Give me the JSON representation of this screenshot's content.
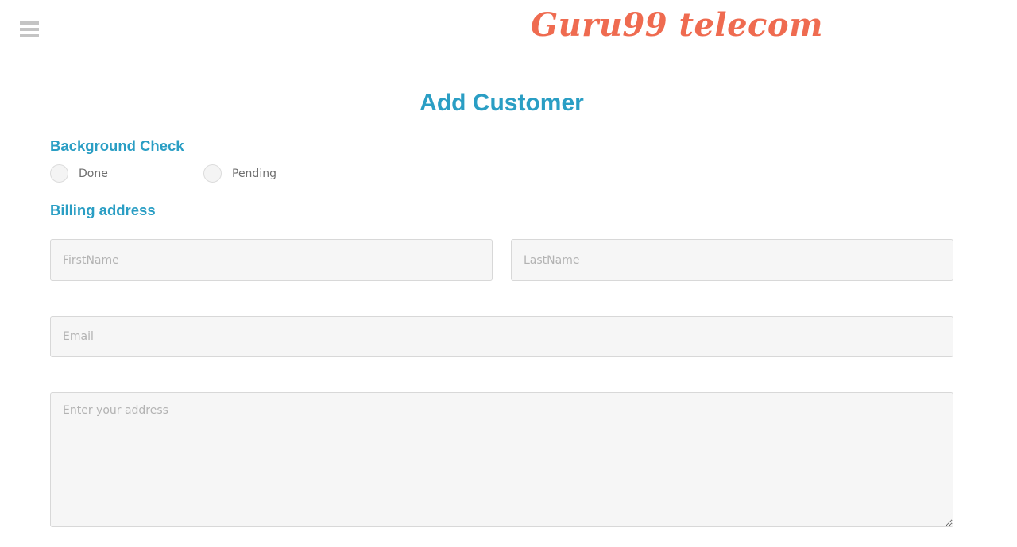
{
  "header": {
    "brand": "Guru99 telecom",
    "menu_icon": "hamburger-menu-icon"
  },
  "page": {
    "title": "Add Customer"
  },
  "background_check": {
    "heading": "Background Check",
    "options": [
      {
        "label": "Done",
        "selected": false
      },
      {
        "label": "Pending",
        "selected": false
      }
    ]
  },
  "billing": {
    "heading": "Billing address",
    "first_name": {
      "value": "",
      "placeholder": "FirstName"
    },
    "last_name": {
      "value": "",
      "placeholder": "LastName"
    },
    "email": {
      "value": "",
      "placeholder": "Email"
    },
    "address": {
      "value": "",
      "placeholder": "Enter your address"
    }
  },
  "colors": {
    "brand": "#ef6b50",
    "accent": "#2a9ec4",
    "field_bg": "#f6f6f6"
  }
}
